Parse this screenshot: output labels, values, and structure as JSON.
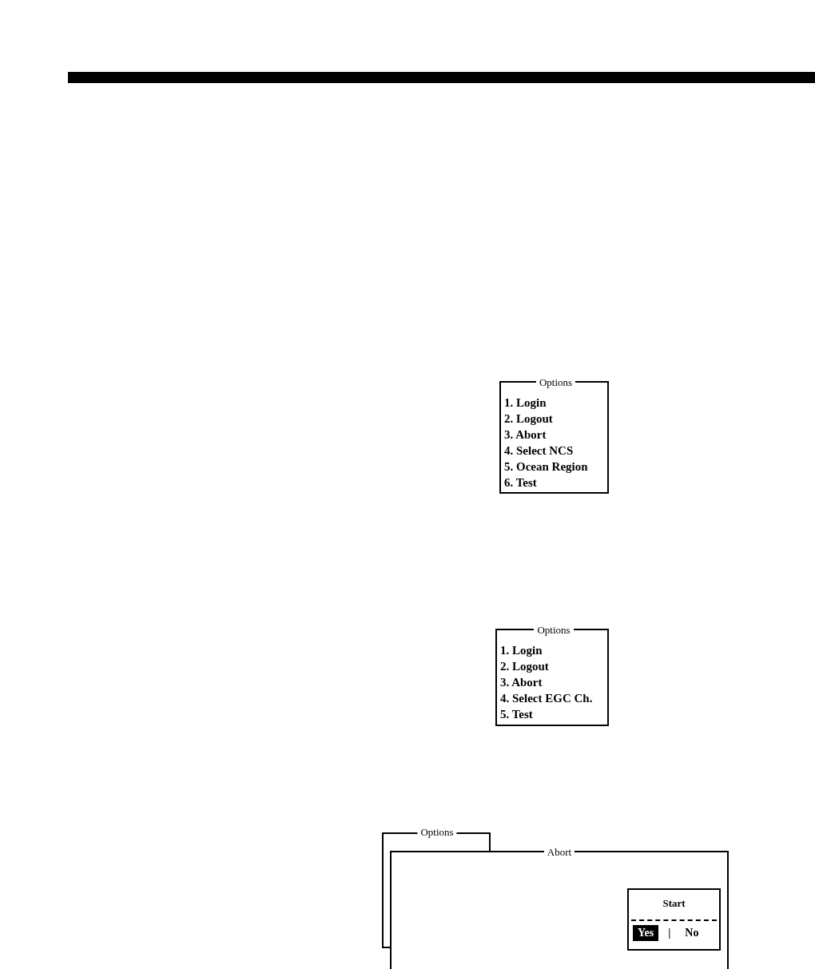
{
  "menus": [
    {
      "title": "Options",
      "items": [
        "1. Login",
        "2. Logout",
        "3. Abort",
        "4. Select NCS",
        "5. Ocean Region",
        "6. Test"
      ]
    },
    {
      "title": "Options",
      "items": [
        "1. Login",
        "2. Logout",
        "3. Abort",
        "4. Select EGC Ch.",
        "5. Test"
      ]
    }
  ],
  "abort_screen": {
    "background_window": {
      "title": "Options"
    },
    "dialog": {
      "title": "Abort",
      "prompt": {
        "title": "Start",
        "separator": "|",
        "options": [
          {
            "label": "Yes",
            "selected": true
          },
          {
            "label": "No",
            "selected": false
          }
        ]
      }
    }
  }
}
